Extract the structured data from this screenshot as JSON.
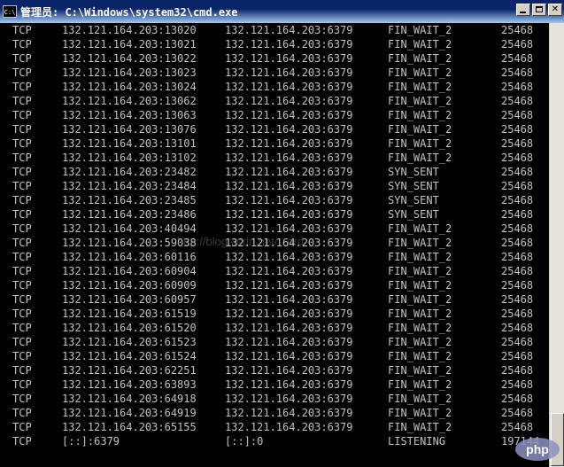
{
  "window": {
    "title": "管理员: C:\\Windows\\system32\\cmd.exe",
    "icon_label": "C:\\"
  },
  "colors": {
    "console_bg": "#000000",
    "console_fg": "#c0c0c0",
    "titlebar": "#0a246a"
  },
  "rows": [
    {
      "proto": "TCP",
      "local": "132.121.164.203:13020",
      "foreign": "132.121.164.203:6379",
      "state": "FIN_WAIT_2",
      "pid": "25468"
    },
    {
      "proto": "TCP",
      "local": "132.121.164.203:13021",
      "foreign": "132.121.164.203:6379",
      "state": "FIN_WAIT_2",
      "pid": "25468"
    },
    {
      "proto": "TCP",
      "local": "132.121.164.203:13022",
      "foreign": "132.121.164.203:6379",
      "state": "FIN_WAIT_2",
      "pid": "25468"
    },
    {
      "proto": "TCP",
      "local": "132.121.164.203:13023",
      "foreign": "132.121.164.203:6379",
      "state": "FIN_WAIT_2",
      "pid": "25468"
    },
    {
      "proto": "TCP",
      "local": "132.121.164.203:13024",
      "foreign": "132.121.164.203:6379",
      "state": "FIN_WAIT_2",
      "pid": "25468"
    },
    {
      "proto": "TCP",
      "local": "132.121.164.203:13062",
      "foreign": "132.121.164.203:6379",
      "state": "FIN_WAIT_2",
      "pid": "25468"
    },
    {
      "proto": "TCP",
      "local": "132.121.164.203:13063",
      "foreign": "132.121.164.203:6379",
      "state": "FIN_WAIT_2",
      "pid": "25468"
    },
    {
      "proto": "TCP",
      "local": "132.121.164.203:13076",
      "foreign": "132.121.164.203:6379",
      "state": "FIN_WAIT_2",
      "pid": "25468"
    },
    {
      "proto": "TCP",
      "local": "132.121.164.203:13101",
      "foreign": "132.121.164.203:6379",
      "state": "FIN_WAIT_2",
      "pid": "25468"
    },
    {
      "proto": "TCP",
      "local": "132.121.164.203:13102",
      "foreign": "132.121.164.203:6379",
      "state": "FIN_WAIT_2",
      "pid": "25468"
    },
    {
      "proto": "TCP",
      "local": "132.121.164.203:23482",
      "foreign": "132.121.164.203:6379",
      "state": "SYN_SENT",
      "pid": "25468"
    },
    {
      "proto": "TCP",
      "local": "132.121.164.203:23484",
      "foreign": "132.121.164.203:6379",
      "state": "SYN_SENT",
      "pid": "25468"
    },
    {
      "proto": "TCP",
      "local": "132.121.164.203:23485",
      "foreign": "132.121.164.203:6379",
      "state": "SYN_SENT",
      "pid": "25468"
    },
    {
      "proto": "TCP",
      "local": "132.121.164.203:23486",
      "foreign": "132.121.164.203:6379",
      "state": "SYN_SENT",
      "pid": "25468"
    },
    {
      "proto": "TCP",
      "local": "132.121.164.203:40494",
      "foreign": "132.121.164.203:6379",
      "state": "FIN_WAIT_2",
      "pid": "25468"
    },
    {
      "proto": "TCP",
      "local": "132.121.164.203:59038",
      "foreign": "132.121.164.203:6379",
      "state": "FIN_WAIT_2",
      "pid": "25468"
    },
    {
      "proto": "TCP",
      "local": "132.121.164.203:60116",
      "foreign": "132.121.164.203:6379",
      "state": "FIN_WAIT_2",
      "pid": "25468"
    },
    {
      "proto": "TCP",
      "local": "132.121.164.203:60904",
      "foreign": "132.121.164.203:6379",
      "state": "FIN_WAIT_2",
      "pid": "25468"
    },
    {
      "proto": "TCP",
      "local": "132.121.164.203:60909",
      "foreign": "132.121.164.203:6379",
      "state": "FIN_WAIT_2",
      "pid": "25468"
    },
    {
      "proto": "TCP",
      "local": "132.121.164.203:60957",
      "foreign": "132.121.164.203:6379",
      "state": "FIN_WAIT_2",
      "pid": "25468"
    },
    {
      "proto": "TCP",
      "local": "132.121.164.203:61519",
      "foreign": "132.121.164.203:6379",
      "state": "FIN_WAIT_2",
      "pid": "25468"
    },
    {
      "proto": "TCP",
      "local": "132.121.164.203:61520",
      "foreign": "132.121.164.203:6379",
      "state": "FIN_WAIT_2",
      "pid": "25468"
    },
    {
      "proto": "TCP",
      "local": "132.121.164.203:61523",
      "foreign": "132.121.164.203:6379",
      "state": "FIN_WAIT_2",
      "pid": "25468"
    },
    {
      "proto": "TCP",
      "local": "132.121.164.203:61524",
      "foreign": "132.121.164.203:6379",
      "state": "FIN_WAIT_2",
      "pid": "25468"
    },
    {
      "proto": "TCP",
      "local": "132.121.164.203:62251",
      "foreign": "132.121.164.203:6379",
      "state": "FIN_WAIT_2",
      "pid": "25468"
    },
    {
      "proto": "TCP",
      "local": "132.121.164.203:63893",
      "foreign": "132.121.164.203:6379",
      "state": "FIN_WAIT_2",
      "pid": "25468"
    },
    {
      "proto": "TCP",
      "local": "132.121.164.203:64918",
      "foreign": "132.121.164.203:6379",
      "state": "FIN_WAIT_2",
      "pid": "25468"
    },
    {
      "proto": "TCP",
      "local": "132.121.164.203:64919",
      "foreign": "132.121.164.203:6379",
      "state": "FIN_WAIT_2",
      "pid": "25468"
    },
    {
      "proto": "TCP",
      "local": "132.121.164.203:65155",
      "foreign": "132.121.164.203:6379",
      "state": "FIN_WAIT_2",
      "pid": "25468"
    },
    {
      "proto": "TCP",
      "local": "[::]:6379",
      "foreign": "[::]:0",
      "state": "LISTENING",
      "pid": "197144"
    }
  ],
  "watermark": "http://blog.csdn.net/...ord",
  "corner_logo": "php"
}
